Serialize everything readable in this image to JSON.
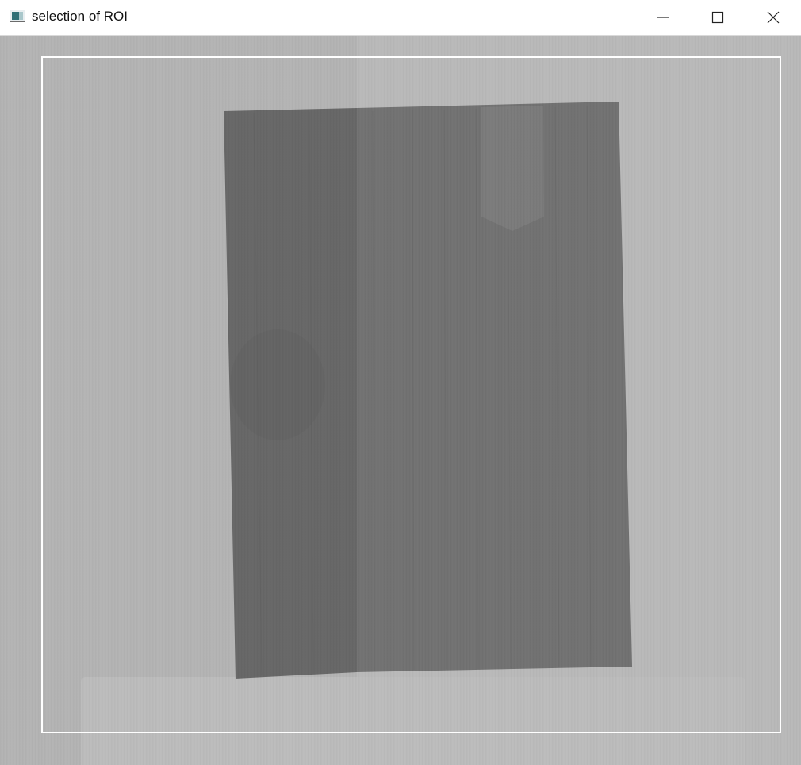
{
  "window": {
    "title": "selection of ROI",
    "icons": {
      "app": "app-window-icon",
      "minimize": "minimize-icon",
      "maximize": "maximize-icon",
      "close": "close-icon"
    }
  },
  "viewer": {
    "content": "grayscale image with selection rectangle",
    "colors": {
      "background": "#b4b4b4",
      "object_left": "#676767",
      "object_right": "#737373",
      "roi_border": "#ffffff"
    }
  }
}
